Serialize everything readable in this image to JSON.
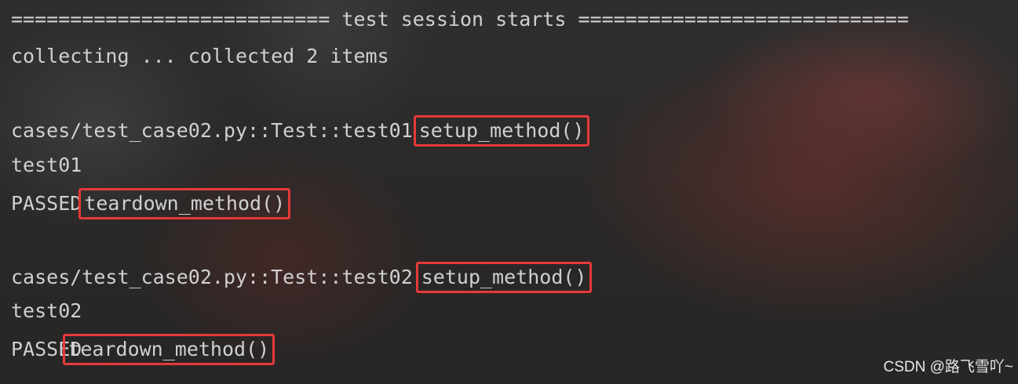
{
  "console": {
    "header": "=========================== test session starts ============================",
    "collecting": "collecting ... collected 2 items",
    "test1": {
      "path": "cases/test_case02.py::Test::test01",
      "setup": "setup_method()",
      "output": "test01",
      "status": "PASSED",
      "teardown": "teardown_method()"
    },
    "test2": {
      "path": "cases/test_case02.py::Test::test02",
      "setup": "setup_method()",
      "output": "test02",
      "status": "PASSED",
      "teardown": "teardown_method()"
    }
  },
  "watermark": "CSDN @路飞雪吖~",
  "colors": {
    "text": "#d0d0d0",
    "highlight_border": "#e5393a",
    "background": "#2b2b2b"
  }
}
